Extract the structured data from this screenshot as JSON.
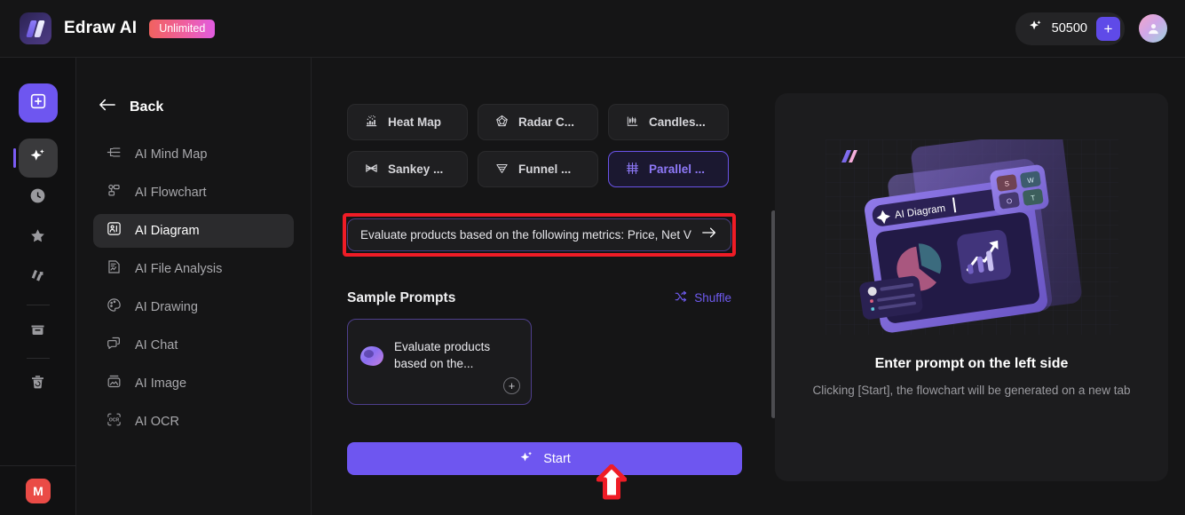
{
  "header": {
    "brand_name": "Edraw AI",
    "badge": "Unlimited",
    "credits": "50500",
    "credit_add_label": "+",
    "logo_icon": "edraw-logo-icon",
    "sparkle_icon": "sparkle-icon",
    "avatar_icon": "user-avatar-icon"
  },
  "rail": {
    "items": [
      {
        "name": "new-document",
        "icon": "plus-square-icon"
      },
      {
        "name": "ai-tools",
        "icon": "sparkle-icon"
      },
      {
        "name": "recent",
        "icon": "clock-icon"
      },
      {
        "name": "favorites",
        "icon": "star-icon"
      },
      {
        "name": "templates",
        "icon": "templates-icon"
      },
      {
        "name": "archive",
        "icon": "box-icon"
      },
      {
        "name": "trash",
        "icon": "trash-icon"
      }
    ],
    "bottom_badge": "M"
  },
  "sidebar": {
    "back_label": "Back",
    "back_icon": "arrow-left-icon",
    "items": [
      {
        "label": "AI Mind Map",
        "icon": "mind-map-icon",
        "active": false
      },
      {
        "label": "AI Flowchart",
        "icon": "flowchart-icon",
        "active": false
      },
      {
        "label": "AI Diagram",
        "icon": "diagram-icon",
        "active": true
      },
      {
        "label": "AI File Analysis",
        "icon": "file-analysis-icon",
        "active": false
      },
      {
        "label": "AI Drawing",
        "icon": "palette-icon",
        "active": false
      },
      {
        "label": "AI Chat",
        "icon": "chat-bubble-icon",
        "active": false
      },
      {
        "label": "AI Image",
        "icon": "image-icon",
        "active": false
      },
      {
        "label": "AI OCR",
        "icon": "ocr-icon",
        "active": false
      }
    ]
  },
  "main": {
    "chart_types": [
      {
        "label": "Heat Map",
        "icon": "heat-map-icon",
        "selected": false
      },
      {
        "label": "Radar C...",
        "icon": "radar-chart-icon",
        "selected": false
      },
      {
        "label": "Candles...",
        "icon": "candlestick-icon",
        "selected": false
      },
      {
        "label": "Sankey ...",
        "icon": "sankey-icon",
        "selected": false
      },
      {
        "label": "Funnel ...",
        "icon": "funnel-icon",
        "selected": false
      },
      {
        "label": "Parallel ...",
        "icon": "parallel-coordinates-icon",
        "selected": true
      }
    ],
    "prompt": {
      "value": "Evaluate products based on the following metrics: Price, Net V",
      "placeholder": "Enter your prompt",
      "submit_icon": "arrow-right-icon"
    },
    "sample_prompts": {
      "title": "Sample Prompts",
      "shuffle_label": "Shuffle",
      "shuffle_icon": "shuffle-icon",
      "cards": [
        {
          "text": "Evaluate products based on the...",
          "add_label": "+",
          "icon": "prompt-blob-icon"
        }
      ]
    },
    "start": {
      "label": "Start",
      "icon": "sparkle-icon"
    }
  },
  "preview": {
    "title": "Enter prompt on the left side",
    "subtitle": "Clicking [Start], the flowchart will be generated on a new tab",
    "illustration_label": "AI Diagram",
    "illustration_icon": "ai-diagram-illustration"
  },
  "colors": {
    "accent": "#6e56f0",
    "accent_light": "#8e79f8",
    "annotation_red": "#ef1c26",
    "badge_red": "#ea4b46",
    "page_bg": "#151516",
    "panel_bg": "#1c1c1e"
  }
}
